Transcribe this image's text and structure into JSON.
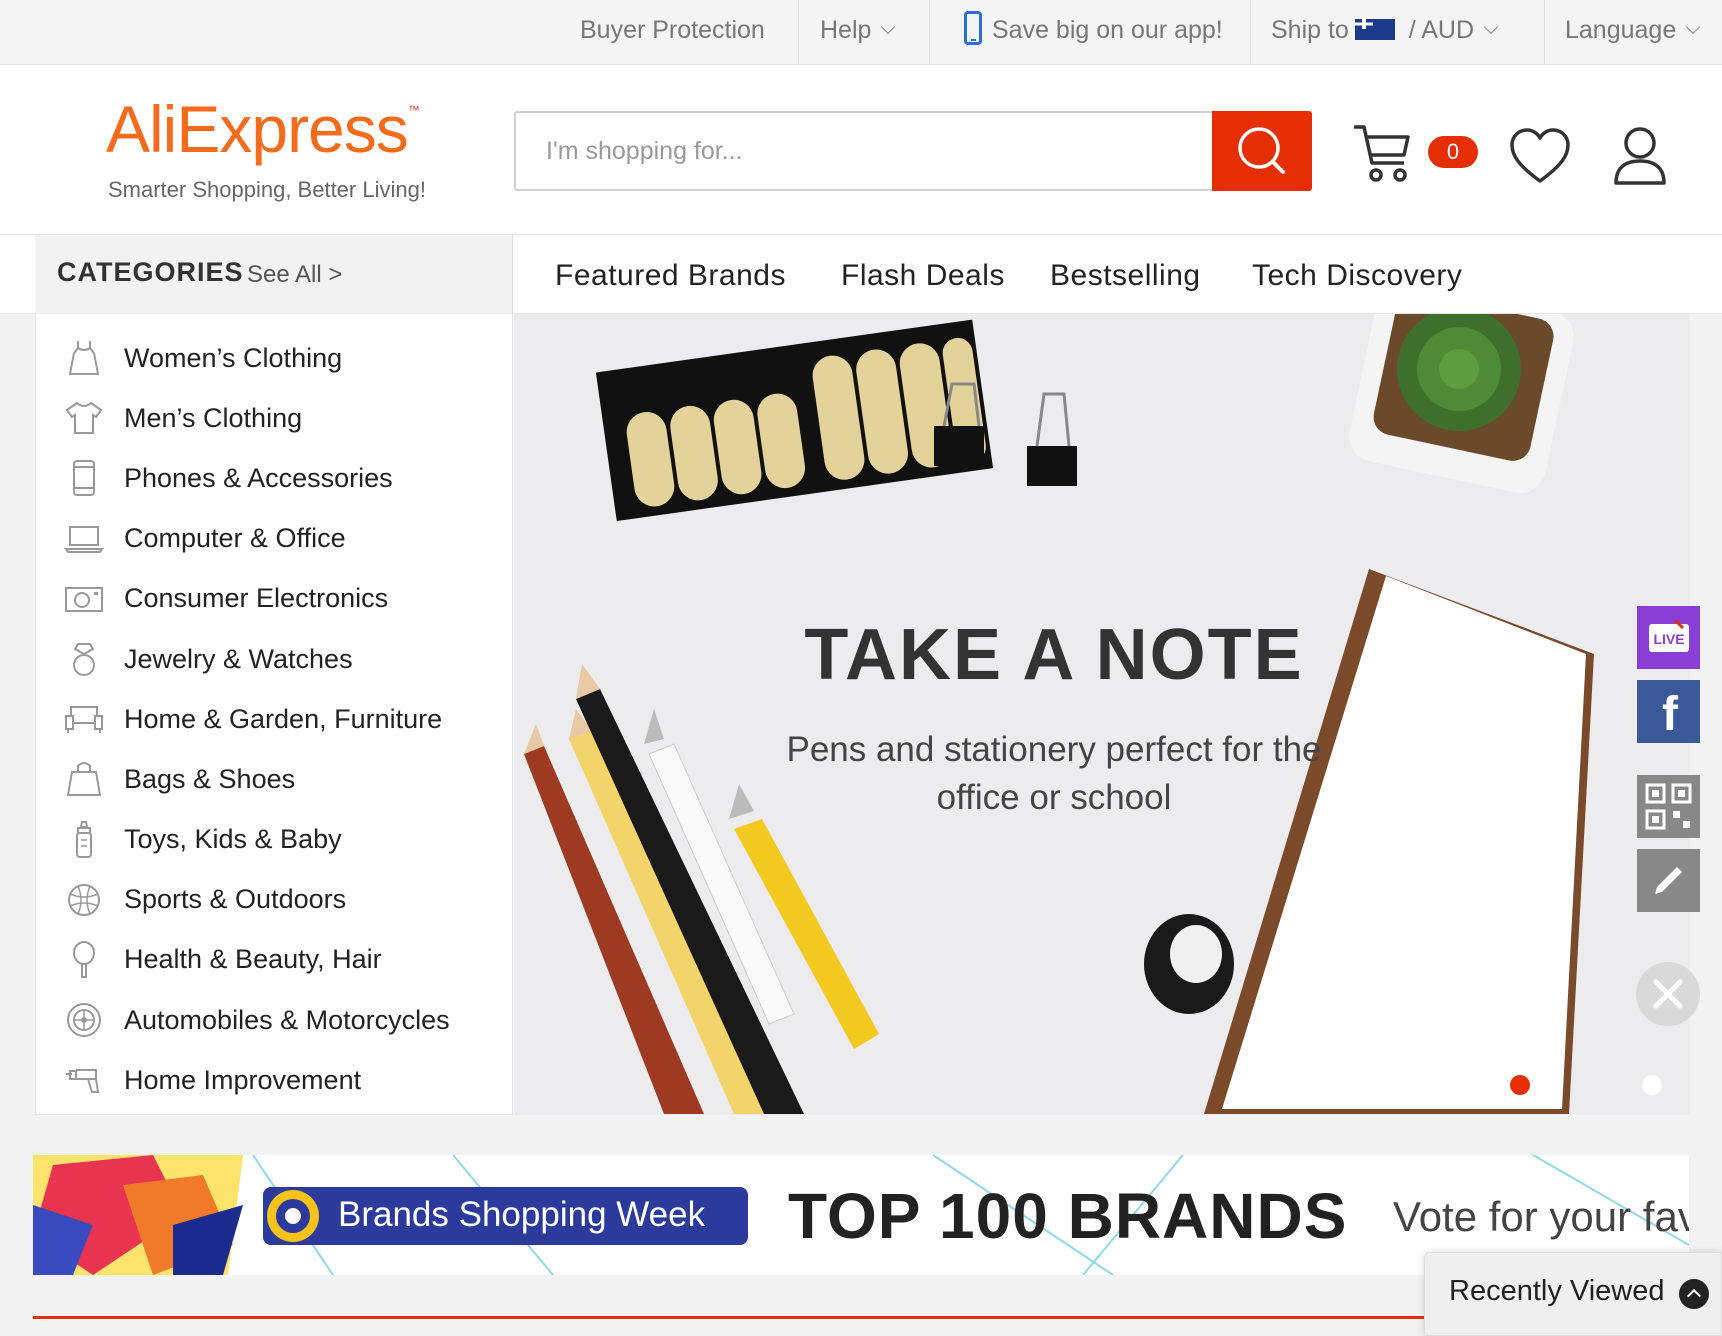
{
  "topbar": {
    "buyer_protection": "Buyer Protection",
    "help": "Help",
    "app_promo": "Save big on our app!",
    "ship_to": "Ship to",
    "currency": "/  AUD",
    "language": "Language"
  },
  "header": {
    "logo": "AliExpress",
    "logo_tm": "™",
    "tagline": "Smarter Shopping, Better Living!",
    "search_placeholder": "I'm shopping for...",
    "cart_count": "0"
  },
  "nav": {
    "categories_title": "CATEGORIES",
    "see_all": "See All >",
    "links": [
      "Featured Brands",
      "Flash Deals",
      "Bestselling",
      "Tech Discovery"
    ]
  },
  "categories": [
    {
      "label": "Women’s Clothing",
      "icon": "dress-icon"
    },
    {
      "label": "Men’s Clothing",
      "icon": "tshirt-icon"
    },
    {
      "label": "Phones & Accessories",
      "icon": "phone-icon"
    },
    {
      "label": "Computer & Office",
      "icon": "laptop-icon"
    },
    {
      "label": "Consumer Electronics",
      "icon": "camera-icon"
    },
    {
      "label": "Jewelry & Watches",
      "icon": "ring-icon"
    },
    {
      "label": "Home & Garden, Furniture",
      "icon": "sofa-icon"
    },
    {
      "label": "Bags & Shoes",
      "icon": "bag-icon"
    },
    {
      "label": "Toys, Kids & Baby",
      "icon": "bottle-icon"
    },
    {
      "label": "Sports & Outdoors",
      "icon": "ball-icon"
    },
    {
      "label": "Health & Beauty, Hair",
      "icon": "mirror-icon"
    },
    {
      "label": "Automobiles & Motorcycles",
      "icon": "wheel-icon"
    },
    {
      "label": "Home Improvement",
      "icon": "drill-icon"
    }
  ],
  "banner": {
    "title": "TAKE A NOTE",
    "subtitle": "Pens and stationery perfect for the office or school",
    "active_slide": 1,
    "slide_count": 2
  },
  "side_rail": {
    "live_label": "LIVE",
    "facebook_label": "f"
  },
  "brand_strip": {
    "badge": "Brands Shopping Week",
    "headline": "TOP 100 BRANDS",
    "tagline": "Vote for your fav"
  },
  "recently_viewed": "Recently Viewed",
  "colors": {
    "accent": "#e62e04",
    "logo_orange": "#f56a1b",
    "live_purple": "#8a3ed6",
    "facebook_blue": "#3b5998"
  }
}
